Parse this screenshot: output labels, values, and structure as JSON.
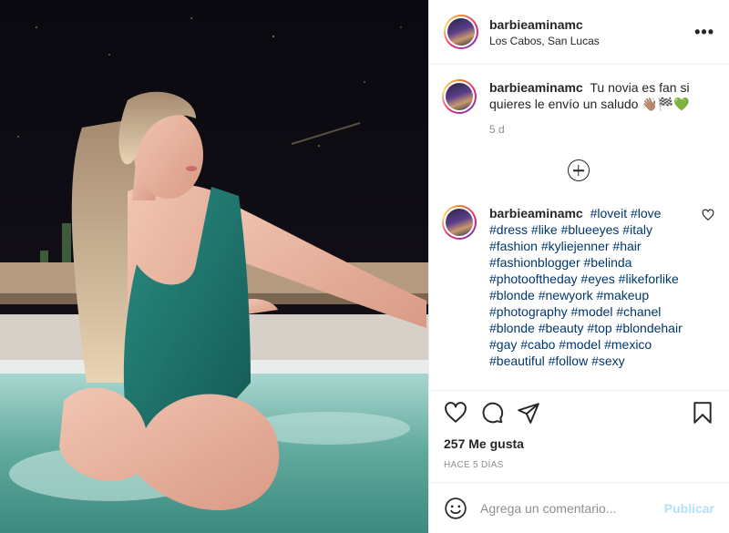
{
  "post": {
    "username": "barbieaminamc",
    "location": "Los Cabos, San Lucas",
    "more_icon": "more-dots-icon"
  },
  "caption": {
    "username": "barbieaminamc",
    "text": "Tu novia es fan si quieres le envío un saludo 👋🏽🏁💚",
    "age": "5 d"
  },
  "load_more_icon": "plus-circle-icon",
  "comment": {
    "username": "barbieaminamc",
    "hashtags": "#loveit #love #dress #like #blueeyes #italy #fashion #kyliejenner #hair #fashionblogger #belinda #photooftheday #eyes #likeforlike #blonde #newyork #makeup #photography #model #chanel #blonde #beauty #top #blondehair #gay #cabo #model #mexico #beautiful #follow #sexy"
  },
  "actions": {
    "icons": [
      "heart-icon",
      "comment-icon",
      "share-icon",
      "bookmark-icon"
    ],
    "likes": "257 Me gusta",
    "date": "HACE 5 DÍAS"
  },
  "add_comment": {
    "placeholder": "Agrega un comentario...",
    "publish_label": "Publicar"
  },
  "colors": {
    "link": "#00376b",
    "publish_disabled": "#b2dffc",
    "muted": "#8e8e8e",
    "swimsuit": "#1f7a72"
  }
}
